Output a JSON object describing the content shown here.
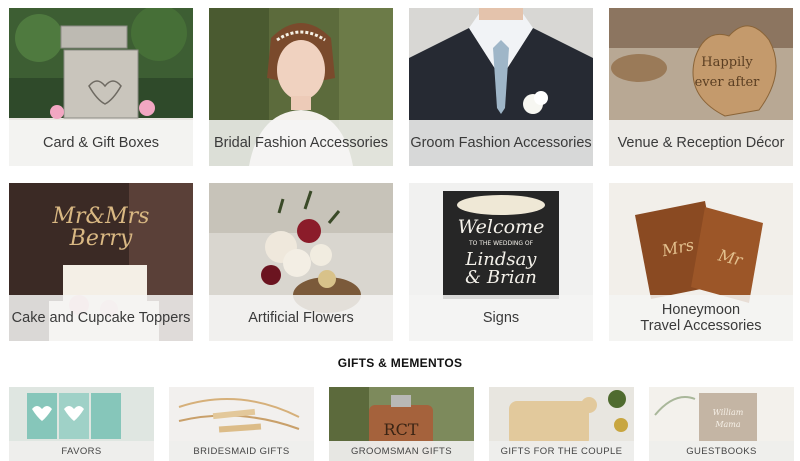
{
  "categories": [
    {
      "label": "Card & Gift Boxes",
      "icon": "card-box-photo"
    },
    {
      "label": "Bridal Fashion Accessories",
      "icon": "bride-photo"
    },
    {
      "label": "Groom Fashion Accessories",
      "icon": "groom-photo"
    },
    {
      "label": "Venue & Reception Décor",
      "icon": "wooden-heart-photo"
    },
    {
      "label": "Cake and Cupcake Toppers",
      "icon": "cake-topper-photo"
    },
    {
      "label": "Artificial Flowers",
      "icon": "bouquet-photo"
    },
    {
      "label": "Signs",
      "icon": "welcome-sign-photo"
    },
    {
      "label": "Honeymoon\nTravel Accessories",
      "icon": "passport-cover-photo"
    }
  ],
  "decor": {
    "heart_text": "Happily ever after",
    "topper_text": "Mr & Mrs Berry",
    "sign_welcome": "Welcome",
    "sign_sub": "TO THE WEDDING OF",
    "sign_names": "Lindsay & Brian",
    "passport_1": "Mrs",
    "passport_2": "Mr",
    "flask_text": "RCT"
  },
  "gifts_section": {
    "title": "GIFTS & MEMENTOS",
    "items": [
      {
        "label": "FAVORS"
      },
      {
        "label": "BRIDESMAID GIFTS"
      },
      {
        "label": "GROOMSMAN GIFTS"
      },
      {
        "label": "GIFTS FOR THE COUPLE"
      },
      {
        "label": "GUESTBOOKS"
      }
    ]
  }
}
